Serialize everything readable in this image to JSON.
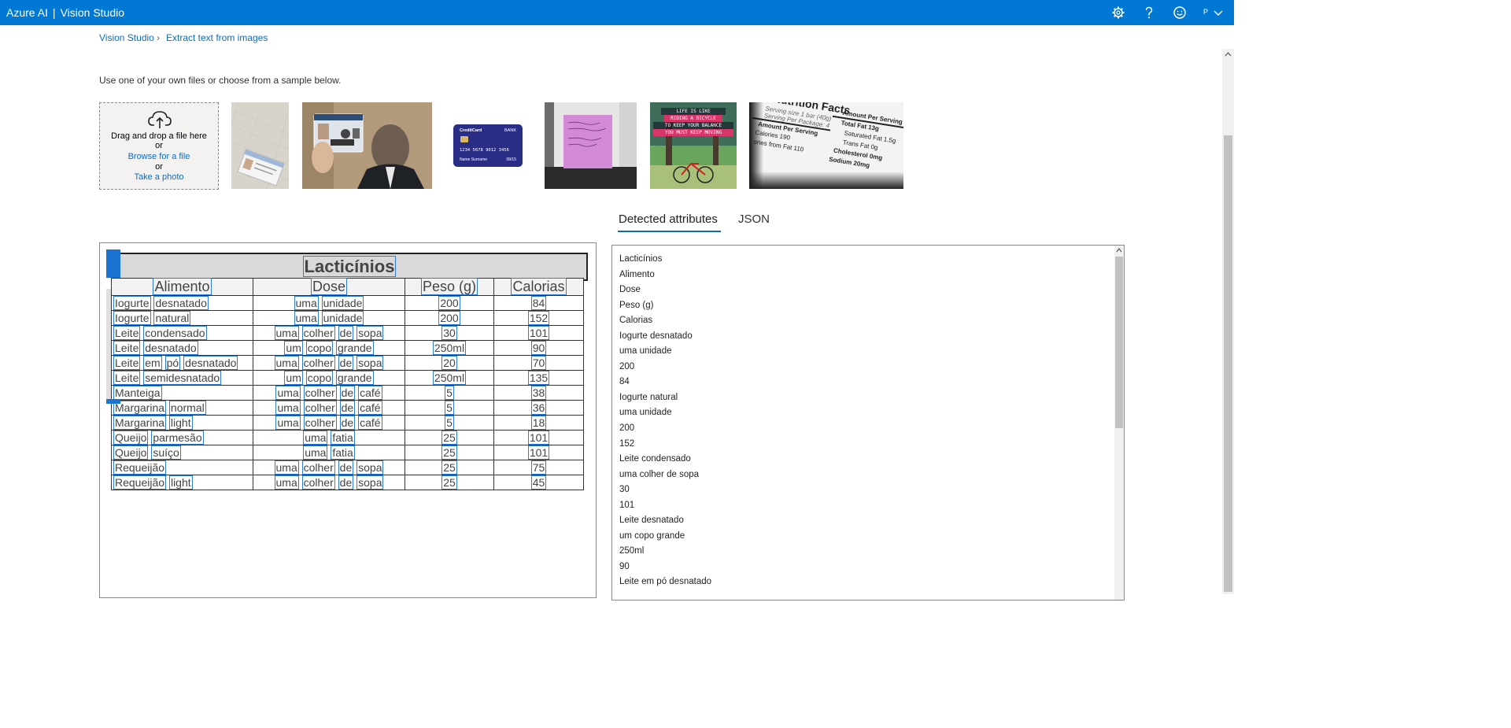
{
  "header": {
    "brand": "Azure AI",
    "product": "Vision Studio",
    "avatar_initial": "P"
  },
  "breadcrumb": {
    "home": "Vision Studio",
    "current": "Extract text from images"
  },
  "intro": "Use one of your own files or choose from a sample below.",
  "dropzone": {
    "drag_text": "Drag and drop a file here",
    "or1": "or",
    "browse": "Browse for a file",
    "or2": "or",
    "photo": "Take a photo"
  },
  "samples": {
    "credit_card_brand": "CreditCard",
    "credit_card_bank": "BANK",
    "credit_card_number": "1234 5678 9012 3456",
    "credit_card_name": "Name Surname",
    "credit_card_expiry": "08/15",
    "poster_lines": [
      "LIFE IS LIKE",
      "RIDING A BICYCLE",
      "TO KEEP YOUR BALANCE",
      "YOU MUST KEEP MOVING"
    ],
    "nutrition_title": "Nutrition Facts",
    "nutrition_serving": "Serving size 1 bar (40g)",
    "nutrition_per_package": "Serving Per Package: 4",
    "nutrition_amount": "Amount Per Serving",
    "nutrition_calories": "Calories 190",
    "nutrition_fat_cal": "ories from Fat 110",
    "nutrition_total_fat": "Total Fat 13g",
    "nutrition_sat_fat": "Saturated Fat 1.5g",
    "nutrition_trans_fat": "Trans Fat 0g",
    "nutrition_chol": "Cholesterol 0mg",
    "nutrition_sodium": "Sodium 20mg"
  },
  "tabs": {
    "detected": "Detected attributes",
    "json": "JSON"
  },
  "ocr_image": {
    "title": "Lacticínios",
    "headers": [
      "Alimento",
      "Dose",
      "Peso (g)",
      "Calorias"
    ],
    "rows": [
      [
        "Iogurte desnatado",
        "uma unidade",
        "200",
        "84"
      ],
      [
        "Iogurte natural",
        "uma unidade",
        "200",
        "152"
      ],
      [
        "Leite condensado",
        "uma colher de sopa",
        "30",
        "101"
      ],
      [
        "Leite desnatado",
        "um copo grande",
        "250ml",
        "90"
      ],
      [
        "Leite em pó desnatado",
        "uma colher de sopa",
        "20",
        "70"
      ],
      [
        "Leite semidesnatado",
        "um copo grande",
        "250ml",
        "135"
      ],
      [
        "Manteiga",
        "uma colher de café",
        "5",
        "38"
      ],
      [
        "Margarina normal",
        "uma colher de café",
        "5",
        "36"
      ],
      [
        "Margarina light",
        "uma colher de café",
        "5",
        "18"
      ],
      [
        "Queijo parmesão",
        "uma fatia",
        "25",
        "101"
      ],
      [
        "Queijo suíço",
        "uma fatia",
        "25",
        "101"
      ],
      [
        "Requeijão",
        "uma colher de sopa",
        "25",
        "75"
      ],
      [
        "Requeijão light",
        "uma colher de sopa",
        "25",
        "45"
      ]
    ]
  },
  "attributes": [
    "Lacticínios",
    "Alimento",
    "Dose",
    "Peso (g)",
    "Calorias",
    "Iogurte desnatado",
    "uma unidade",
    "200",
    "84",
    "Iogurte natural",
    "uma unidade",
    "200",
    "152",
    "Leite condensado",
    "uma colher de sopa",
    "30",
    "101",
    "Leite desnatado",
    "um copo grande",
    "250ml",
    "90",
    "Leite em pó desnatado"
  ],
  "colors": {
    "topbar": "#0078d4",
    "link": "#0f6cbd",
    "ocr_box": "#2e7cd6"
  },
  "icons": {
    "settings": "gear-icon",
    "help": "help-icon",
    "feedback": "smiley-icon",
    "upload": "cloud-upload-icon"
  }
}
